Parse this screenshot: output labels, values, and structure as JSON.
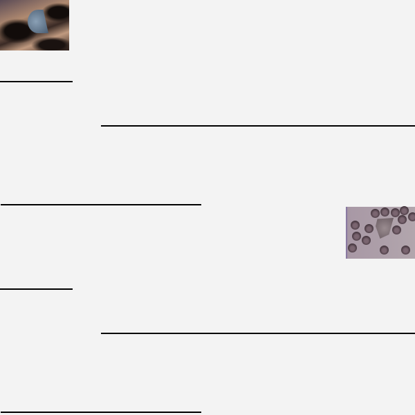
{
  "colors": {
    "background": "#f3f3f3",
    "line": "#000000"
  }
}
